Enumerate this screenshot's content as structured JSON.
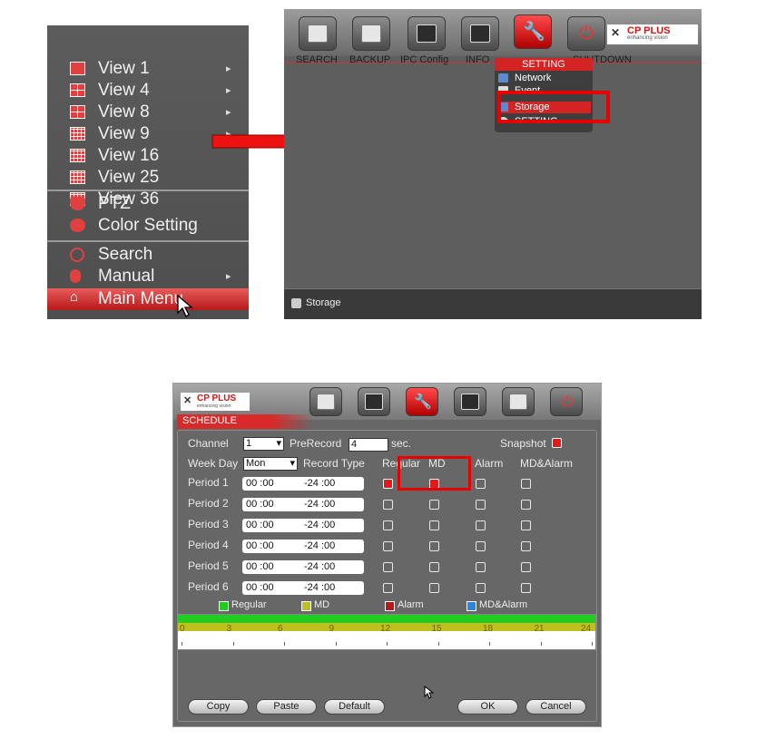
{
  "context_menu": {
    "items": [
      {
        "label": "View 1",
        "arrow": "▸"
      },
      {
        "label": "View 4",
        "arrow": "▸"
      },
      {
        "label": "View 8",
        "arrow": "▸"
      },
      {
        "label": "View 9",
        "arrow": "▸"
      },
      {
        "label": "View 16",
        "arrow": ""
      },
      {
        "label": "View 25",
        "arrow": ""
      },
      {
        "label": "View 36",
        "arrow": ""
      },
      {
        "label": "PTZ",
        "arrow": ""
      },
      {
        "label": "Color Setting",
        "arrow": ""
      },
      {
        "label": "Search",
        "arrow": ""
      },
      {
        "label": "Manual",
        "arrow": "▸"
      },
      {
        "label": "Main Menu",
        "arrow": ""
      }
    ]
  },
  "main_menu": {
    "toolbar": [
      "SEARCH",
      "BACKUP",
      "IPC Config",
      "INFO",
      "SETTING",
      "SHUTDOWN"
    ],
    "logo_text": "CP PLUS",
    "logo_tagline": "enhancing vision",
    "dropdown": {
      "header": "SETTING",
      "items": [
        "Network",
        "Event",
        "Storage",
        "SETTING"
      ]
    },
    "status": "Storage"
  },
  "schedule": {
    "logo_text": "CP PLUS",
    "logo_tagline": "enhancing vision",
    "tab": "SCHEDULE",
    "channel_label": "Channel",
    "channel_value": "1",
    "prerecord_label": "PreRecord",
    "prerecord_value": "4",
    "sec_label": "sec.",
    "snapshot_label": "Snapshot",
    "weekday_label": "Week Day",
    "weekday_value": "Mon",
    "record_type_label": "Record Type",
    "col_regular": "Regular",
    "col_md": "MD",
    "col_alarm": "Alarm",
    "col_mdalarm": "MD&Alarm",
    "periods": [
      {
        "label": "Period 1",
        "start": "00 :00",
        "end": "-24 :00",
        "checks": [
          true,
          true,
          false,
          false
        ]
      },
      {
        "label": "Period 2",
        "start": "00 :00",
        "end": "-24 :00",
        "checks": [
          false,
          false,
          false,
          false
        ]
      },
      {
        "label": "Period 3",
        "start": "00 :00",
        "end": "-24 :00",
        "checks": [
          false,
          false,
          false,
          false
        ]
      },
      {
        "label": "Period 4",
        "start": "00 :00",
        "end": "-24 :00",
        "checks": [
          false,
          false,
          false,
          false
        ]
      },
      {
        "label": "Period 5",
        "start": "00 :00",
        "end": "-24 :00",
        "checks": [
          false,
          false,
          false,
          false
        ]
      },
      {
        "label": "Period 6",
        "start": "00 :00",
        "end": "-24 :00",
        "checks": [
          false,
          false,
          false,
          false
        ]
      }
    ],
    "legend": [
      "Regular",
      "MD",
      "Alarm",
      "MD&Alarm"
    ],
    "legend_colors": [
      "#20cc20",
      "#bfbf1e",
      "#b81818",
      "#2a86e0"
    ],
    "ticks": [
      "0",
      "3",
      "6",
      "9",
      "12",
      "15",
      "18",
      "21",
      "24"
    ],
    "buttons": {
      "copy": "Copy",
      "paste": "Paste",
      "default": "Default",
      "ok": "OK",
      "cancel": "Cancel"
    }
  }
}
